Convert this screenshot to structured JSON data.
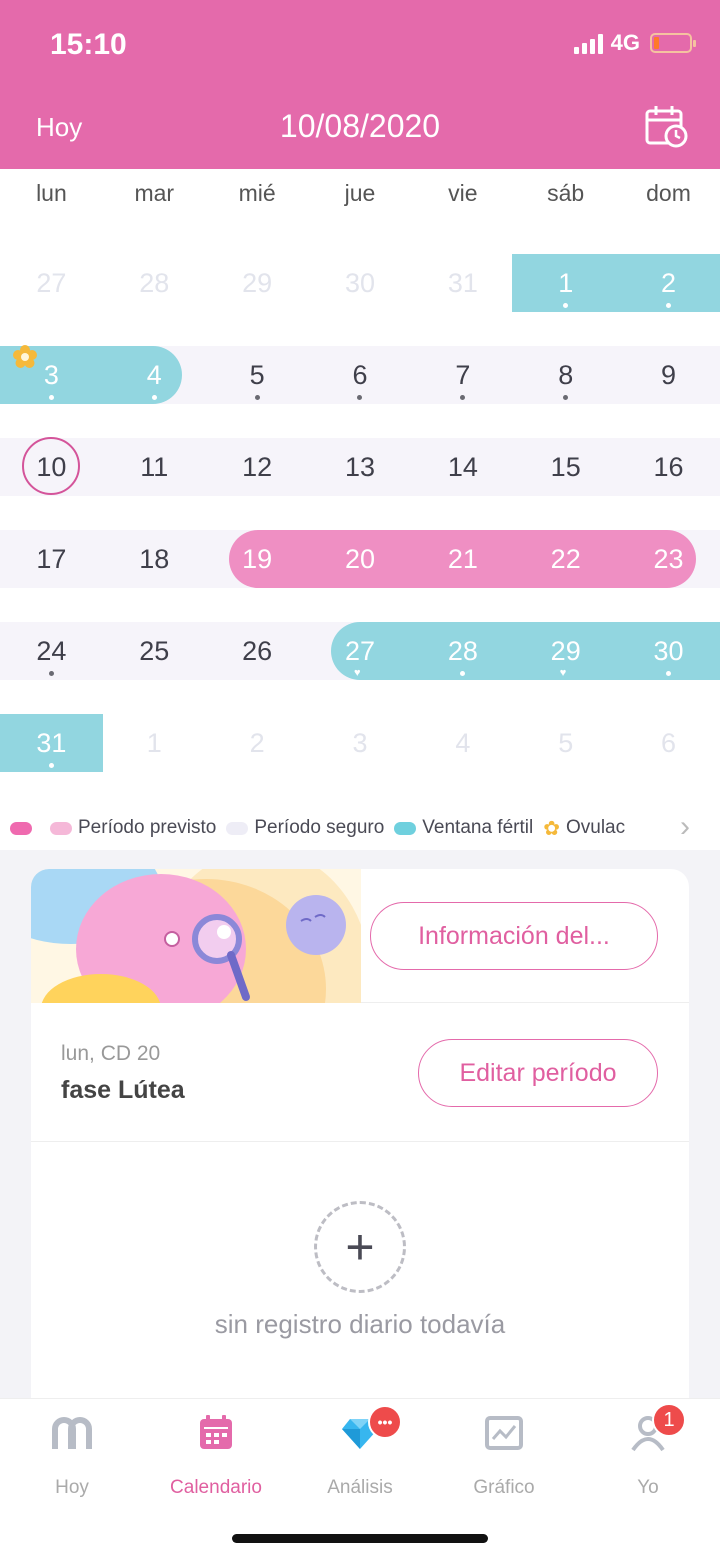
{
  "status_bar": {
    "time": "15:10",
    "network": "4G"
  },
  "header": {
    "today_label": "Hoy",
    "date": "10/08/2020",
    "calendar_icon": "calendar-clock-icon"
  },
  "weekdays": [
    "lun",
    "mar",
    "mié",
    "jue",
    "vie",
    "sáb",
    "dom"
  ],
  "weeks": [
    [
      "27",
      "28",
      "29",
      "30",
      "31",
      "1",
      "2"
    ],
    [
      "3",
      "4",
      "5",
      "6",
      "7",
      "8",
      "9"
    ],
    [
      "10",
      "11",
      "12",
      "13",
      "14",
      "15",
      "16"
    ],
    [
      "17",
      "18",
      "19",
      "20",
      "21",
      "22",
      "23"
    ],
    [
      "24",
      "25",
      "26",
      "27",
      "28",
      "29",
      "30"
    ],
    [
      "31",
      "1",
      "2",
      "3",
      "4",
      "5",
      "6"
    ]
  ],
  "legend": {
    "items": [
      "Período previsto",
      "Período seguro",
      "Ventana fértil",
      "Ovulac"
    ]
  },
  "colors": {
    "brand": "#e46aab",
    "period": "#ef8fc3",
    "fertile": "#92d6e0",
    "safe": "#f6f4fa",
    "ovulation": "#f5b93a"
  },
  "card": {
    "info_button": "Información del...",
    "phase_day": "lun, CD 20",
    "phase_name": "fase Lútea",
    "edit_button": "Editar período",
    "empty_text": "sin registro diario todavía"
  },
  "nav": {
    "items": [
      {
        "label": "Hoy",
        "icon": "hoy-icon"
      },
      {
        "label": "Calendario",
        "icon": "calendar-icon"
      },
      {
        "label": "Análisis",
        "icon": "diamond-icon",
        "badge": "•••"
      },
      {
        "label": "Gráfico",
        "icon": "chart-icon"
      },
      {
        "label": "Yo",
        "icon": "profile-icon",
        "badge": "1"
      }
    ]
  }
}
